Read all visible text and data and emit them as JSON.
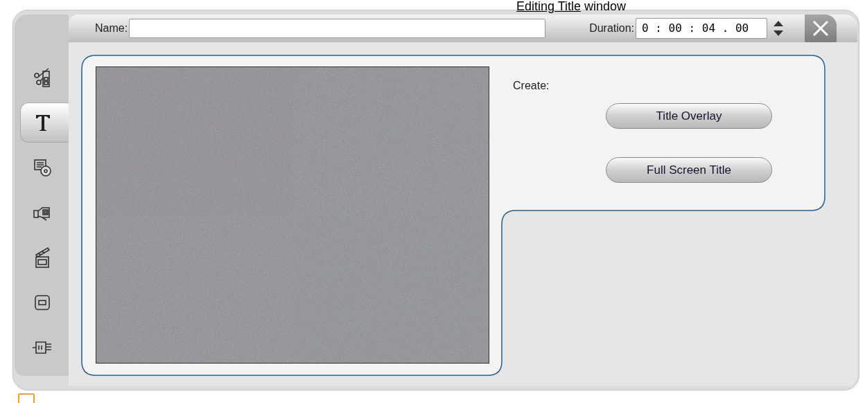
{
  "caption": {
    "link": "Editing Title",
    "rest": "window"
  },
  "sidebar": {
    "items": [
      {
        "kind": "edit",
        "selected": false
      },
      {
        "kind": "title",
        "selected": true
      },
      {
        "kind": "disc-menu",
        "selected": false
      },
      {
        "kind": "camera",
        "selected": false
      },
      {
        "kind": "clapper",
        "selected": false
      },
      {
        "kind": "frame",
        "selected": false
      },
      {
        "kind": "plug",
        "selected": false
      }
    ]
  },
  "header": {
    "name_label": "Name:",
    "duration_label": "Duration:",
    "duration_value": "0 : 00 : 04 . 00"
  },
  "create": {
    "label": "Create:",
    "buttons": [
      "Title Overlay",
      "Full Screen Title"
    ]
  }
}
